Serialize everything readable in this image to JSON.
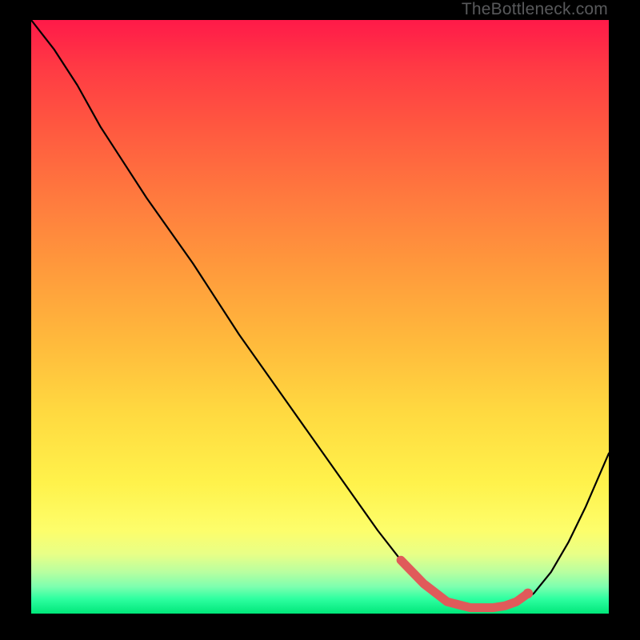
{
  "watermark": "TheBottleneck.com",
  "colors": {
    "curve": "#000000",
    "marker": "#e05a5a",
    "background_top": "#ff1a49",
    "background_bottom": "#00e77a",
    "frame": "#000000"
  },
  "chart_data": {
    "type": "line",
    "title": "",
    "xlabel": "",
    "ylabel": "",
    "xlim": [
      0,
      100
    ],
    "ylim": [
      0,
      100
    ],
    "grid": false,
    "legend": false,
    "note": "No axis ticks or labels are drawn in the image; x and y are normalized 0–100. The curve represents bottleneck percentage vs. a component ratio; the thick highlighted segment marks the low-bottleneck / optimal zone.",
    "series": [
      {
        "name": "bottleneck_curve",
        "x": [
          0,
          4,
          8,
          12,
          16,
          20,
          28,
          36,
          44,
          52,
          60,
          64,
          68,
          71,
          74,
          77,
          80,
          83,
          85,
          87,
          90,
          93,
          96,
          100
        ],
        "y": [
          100,
          95,
          89,
          82,
          76,
          70,
          59,
          47,
          36,
          25,
          14,
          9,
          5,
          3,
          1.5,
          1,
          1,
          1.3,
          2,
          3.4,
          7,
          12,
          18,
          27
        ]
      },
      {
        "name": "optimal_zone_marker",
        "x": [
          64,
          66,
          68,
          70,
          72,
          74,
          76,
          78,
          80,
          82,
          84,
          86
        ],
        "y": [
          9,
          7,
          5,
          3.5,
          2,
          1.5,
          1,
          1,
          1,
          1.3,
          2,
          3.4
        ]
      }
    ]
  }
}
